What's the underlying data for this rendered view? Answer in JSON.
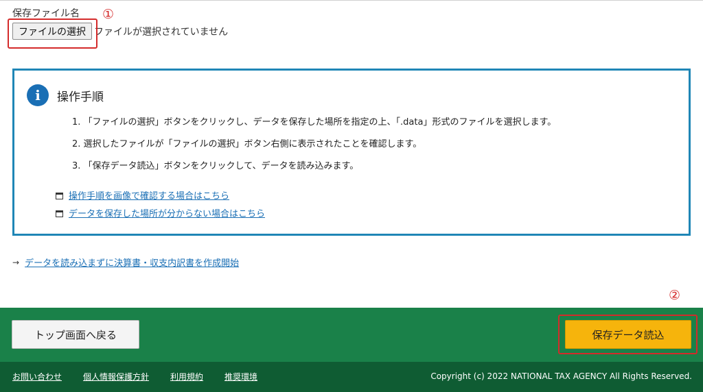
{
  "file_field": {
    "label": "保存ファイル名",
    "button_label": "ファイルの選択",
    "status": "ファイルが選択されていません"
  },
  "annotations": {
    "marker1": "①",
    "marker2": "②",
    "color": "#d42a2a"
  },
  "info": {
    "icon": "i",
    "title": "操作手順",
    "steps": [
      "1. 「ファイルの選択」ボタンをクリックし、データを保存した場所を指定の上、「.data」形式のファイルを選択します。",
      "2. 選択したファイルが「ファイルの選択」ボタン右側に表示されたことを確認します。",
      "3. 「保存データ読込」ボタンをクリックして、データを読み込みます。"
    ],
    "links": [
      "操作手順を画像で確認する場合はこちら",
      "データを保存した場所が分からない場合はこちら"
    ]
  },
  "start_without_data_link": "データを読み込まずに決算書・収支内訳書を作成開始",
  "actions": {
    "back_label": "トップ画面へ戻る",
    "load_label": "保存データ読込"
  },
  "footer": {
    "links": [
      "お問い合わせ",
      "個人情報保護方針",
      "利用規約",
      "推奨環境"
    ],
    "copyright": "Copyright (c) 2022 NATIONAL TAX AGENCY All Rights Reserved."
  },
  "colors": {
    "info_border": "#1f86b6",
    "action_bar": "#1a8149",
    "footer": "#0f5c33",
    "primary_button": "#f6b40c",
    "link": "#1a6fb5"
  }
}
